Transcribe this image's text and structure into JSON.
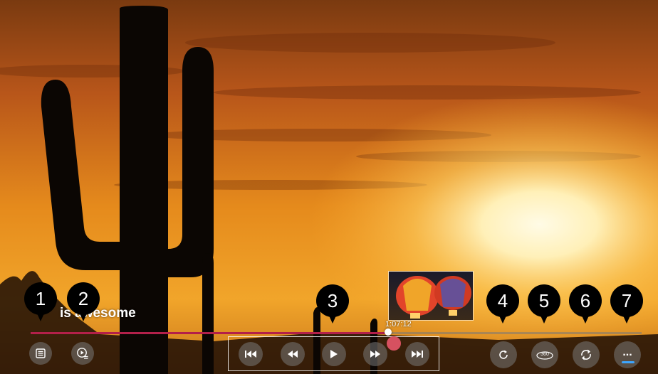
{
  "video": {
    "title": "is awesome",
    "current_time": "1:07:12",
    "progress_fraction": 0.585
  },
  "controls": {
    "left": [
      {
        "name": "playlist-button",
        "icon": "list-icon"
      },
      {
        "name": "autoplay-button",
        "icon": "play-list-icon"
      }
    ],
    "transport": [
      {
        "name": "skip-previous-button",
        "icon": "skip-previous-icon"
      },
      {
        "name": "rewind-button",
        "icon": "rewind-icon"
      },
      {
        "name": "play-button",
        "icon": "play-icon"
      },
      {
        "name": "fast-forward-button",
        "icon": "fast-forward-icon"
      },
      {
        "name": "skip-next-button",
        "icon": "skip-next-icon"
      }
    ],
    "right": [
      {
        "name": "restart-button",
        "icon": "restart-icon"
      },
      {
        "name": "vr-360-button",
        "icon": "vr-360-icon",
        "label": "360"
      },
      {
        "name": "repeat-button",
        "icon": "repeat-icon"
      },
      {
        "name": "more-button",
        "icon": "more-icon",
        "label": "..."
      }
    ]
  },
  "callouts": [
    "1",
    "2",
    "3",
    "4",
    "5",
    "6",
    "7"
  ],
  "colors": {
    "progress": "#b3204a",
    "focus_underline": "#3da6ff",
    "callout_bg": "#000000"
  }
}
